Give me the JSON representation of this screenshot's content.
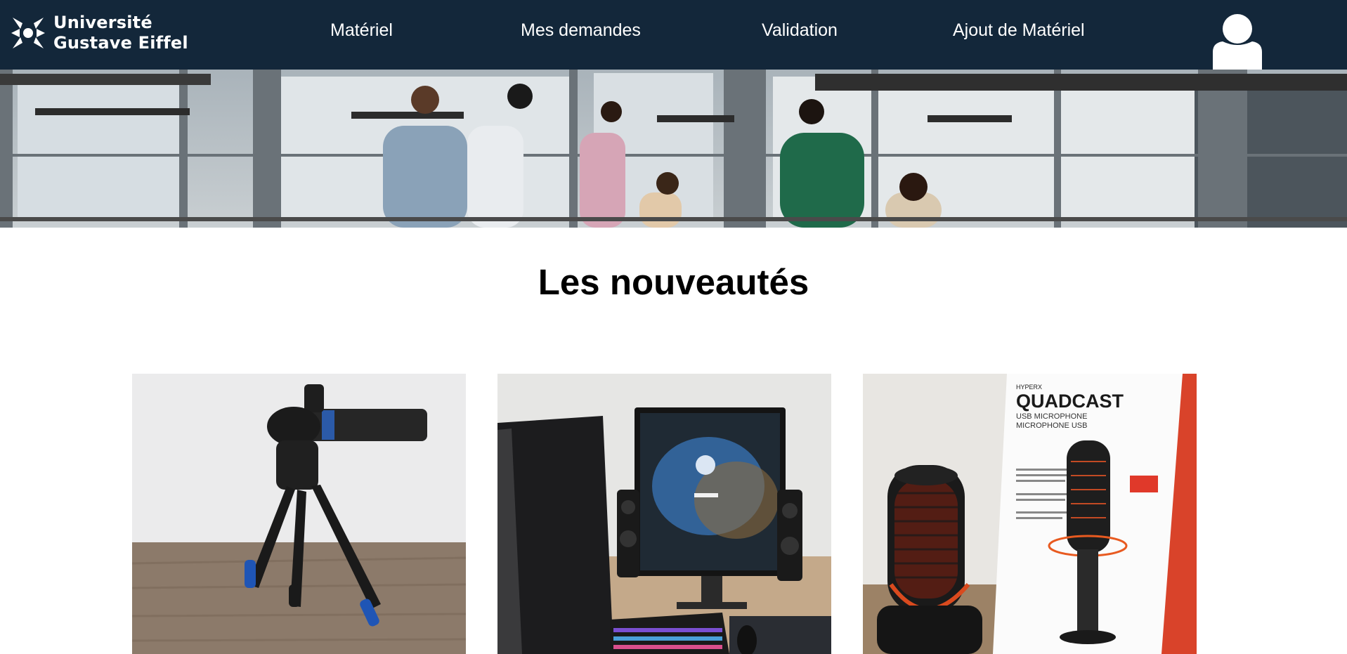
{
  "navbar": {
    "logo": {
      "line1": "Université",
      "line2": "Gustave Eiffel",
      "icon": "university-star-logo"
    },
    "links": [
      {
        "label": "Matériel"
      },
      {
        "label": "Mes demandes"
      },
      {
        "label": "Validation"
      },
      {
        "label": "Ajout de Matériel"
      }
    ],
    "avatar_icon": "user-icon",
    "background": "#13273a"
  },
  "hero": {
    "image": "students-walking-in-library-photo"
  },
  "section": {
    "title": "Les nouveautés"
  },
  "products": [
    {
      "image": "tripod-phone-mount-photo"
    },
    {
      "image": "desktop-computer-setup-photo"
    },
    {
      "image": "hyperx-quadcast-microphone-photo",
      "box_text": [
        "HYPERX",
        "QUADCAST",
        "USB MICROPHONE",
        "MICROPHONE USB"
      ]
    }
  ]
}
